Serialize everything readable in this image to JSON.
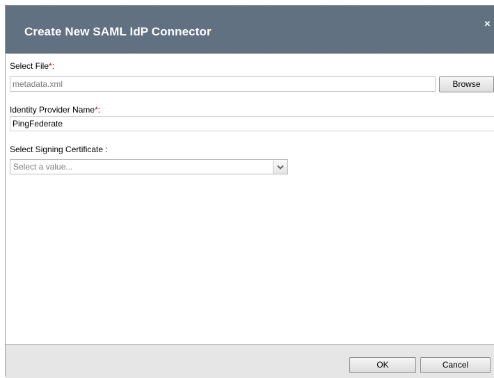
{
  "dialog": {
    "title": "Create New SAML IdP Connector",
    "close_glyph": "×"
  },
  "fields": {
    "select_file": {
      "label": "Select File",
      "required_mark": "*",
      "label_suffix": ":",
      "value": "metadata.xml",
      "browse_label": "Browse"
    },
    "idp_name": {
      "label": "Identity Provider Name",
      "required_mark": "*",
      "label_suffix": ":",
      "value": "PingFederate"
    },
    "signing_cert": {
      "label": "Select Signing Certificate :",
      "placeholder": "Select a value..."
    }
  },
  "footer": {
    "ok_label": "OK",
    "cancel_label": "Cancel"
  },
  "icons": {
    "close": "close-icon",
    "dropdown": "chevron-down-icon"
  },
  "colors": {
    "titlebar": "#5f6f7f",
    "required": "#cc0000",
    "footer": "#e6e6e6"
  }
}
